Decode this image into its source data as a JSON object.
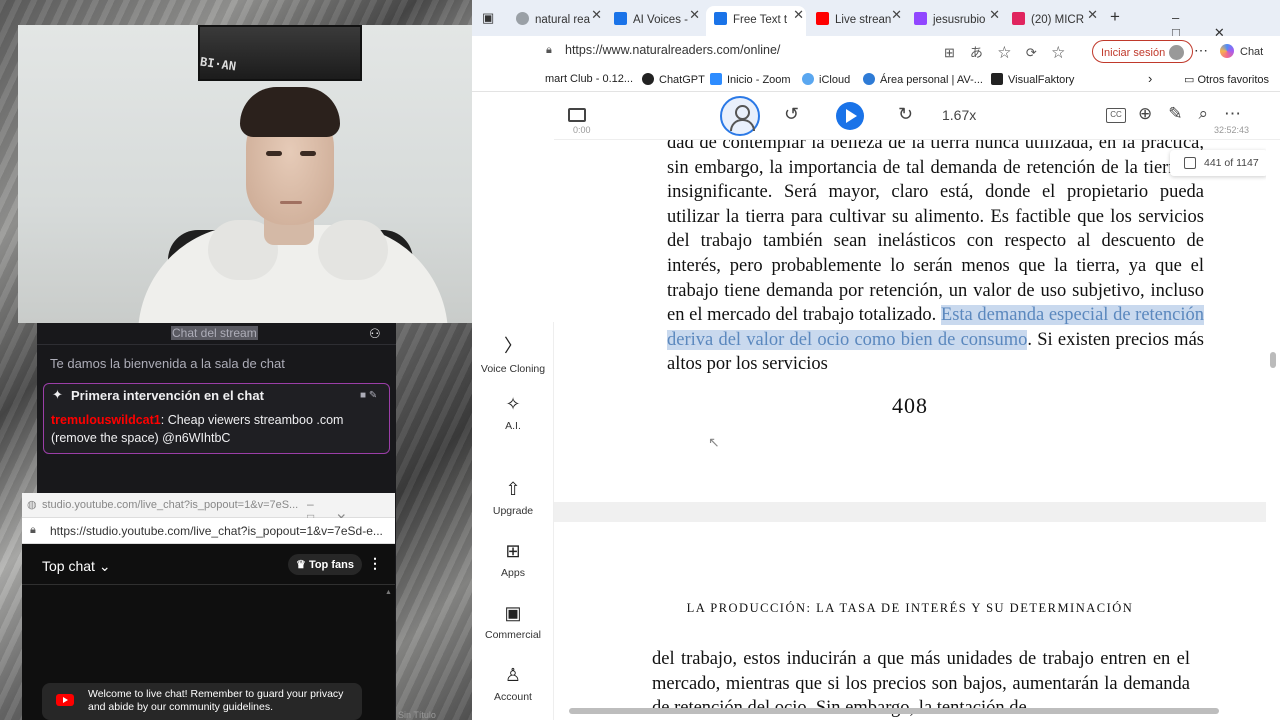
{
  "browser": {
    "tabs": [
      {
        "label": "natural rea",
        "icon_color": "#9aa0a6"
      },
      {
        "label": "AI Voices -",
        "icon_color": "#1a73e8"
      },
      {
        "label": "Free Text t",
        "icon_color": "#1a73e8",
        "active": true
      },
      {
        "label": "Live strean",
        "icon_color": "#ff0000"
      },
      {
        "label": "jesusrubio",
        "icon_color": "#9146ff"
      },
      {
        "label": "(20) MICR",
        "icon_color": "#e0245e"
      }
    ],
    "url": "https://www.naturalreaders.com/online/",
    "login_label": "Iniciar sesión",
    "chat_label": "Chat",
    "bookmarks": [
      {
        "label": "mart Club - 0.12...",
        "icon_color": "#ffffff"
      },
      {
        "label": "ChatGPT",
        "icon_color": "#222222"
      },
      {
        "label": "Inicio - Zoom",
        "icon_color": "#2d8cff"
      },
      {
        "label": "iCloud",
        "icon_color": "#5aa7f0"
      },
      {
        "label": "Área personal | AV-...",
        "icon_color": "#2e7bd6"
      },
      {
        "label": "VisualFaktory",
        "icon_color": "#222222"
      }
    ],
    "bookmarks_other": "Otros favoritos"
  },
  "reader": {
    "time_start": "0:00",
    "time_end": "32:52:43",
    "speed": "1.67x",
    "cc_label": "CC",
    "page_indicator": "441 of 1147",
    "para1_pre": "dad de contemplar la belleza de la tierra nunca utilizada, en la práctica, sin embargo, la importancia de tal demanda de retención de la tierra es insignificante. Será mayor, claro está, donde el propietario pueda utilizar la tierra para cultivar su alimento. Es factible que los servicios del trabajo también sean inelásticos con respecto al descuento de interés, pero probablemente lo serán menos que la tierra, ya que el trabajo tiene demanda por retención, un valor de uso subjetivo, incluso en el mercado del trabajo totalizado. ",
    "para1_highlight": "Esta demanda especial de retención deriva del valor del ocio como bien de consumo",
    "para1_post": ". Si existen precios más altos por los servicios",
    "page_number": "408",
    "chapter_heading": "LA PRODUCCIÓN: LA TASA DE INTERÉS Y SU DETERMINACIÓN",
    "para2": "del trabajo, estos inducirán a que más unidades de trabajo entren en el mercado, mientras que si los precios son bajos, aumentarán la demanda de retención del ocio. Sin embargo, la tentación de"
  },
  "sidebar": [
    {
      "label": "Voice Cloning",
      "icon": "voice-cloning-icon",
      "glyph": "〉"
    },
    {
      "label": "A.I.",
      "icon": "sparkle-icon",
      "glyph": "✧"
    },
    {
      "label": "Upgrade",
      "icon": "upgrade-icon",
      "glyph": "⇧"
    },
    {
      "label": "Apps",
      "icon": "apps-icon",
      "glyph": "⊞"
    },
    {
      "label": "Commercial",
      "icon": "briefcase-icon",
      "glyph": "▣"
    },
    {
      "label": "Account",
      "icon": "account-icon",
      "glyph": "♙"
    }
  ],
  "twitch": {
    "title": "Chat del stream",
    "welcome": "Te damos la bienvenida a la sala de chat",
    "card_title": "Primera intervención en el chat",
    "username": "tremulouswildcat1",
    "message": ": Cheap viewers streamboo .com (remove the space) @n6WIhtbC"
  },
  "youtube": {
    "window_title": "studio.youtube.com/live_chat?is_popout=1&v=7eS...",
    "url": "https://studio.youtube.com/live_chat?is_popout=1&v=7eSd-e...",
    "top_chat": "Top chat",
    "top_fans": "Top fans",
    "welcome": "Welcome to live chat! Remember to guard your privacy and abide by our community guidelines."
  },
  "taskbar_hint": "Sin Título"
}
